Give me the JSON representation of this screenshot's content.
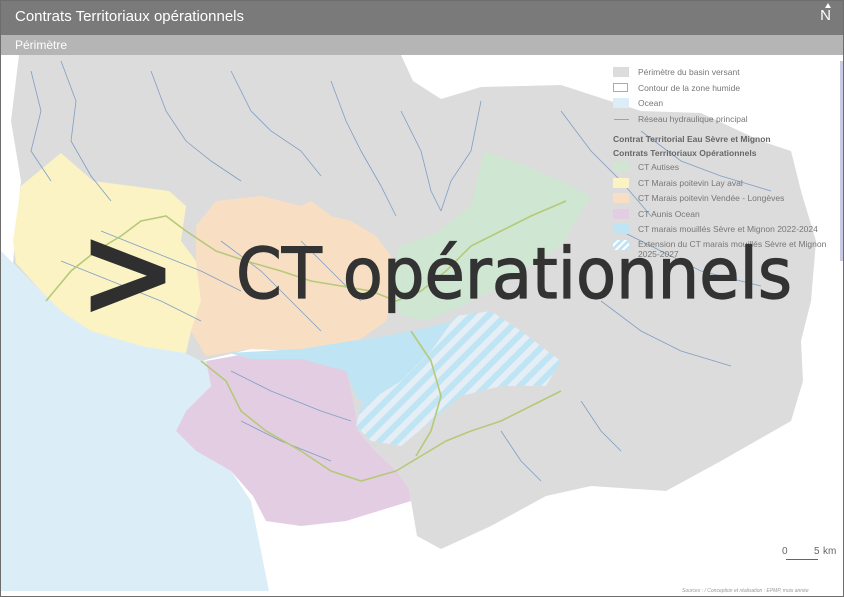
{
  "header": {
    "title": "Contrats Territoriaux opérationnels",
    "north_label": "N"
  },
  "subheader": {
    "title": "Périmètre"
  },
  "overlay": {
    "big_text": "CT opérationnels",
    "chevron_glyph": ">"
  },
  "legend": {
    "basin": "Périmètre du basin versant",
    "wetland": "Contour de la zone humide",
    "ocean": "Ocean",
    "network": "Réseau hydraulique principal",
    "section_heading": "Contrat Territorial Eau Sèvre et Mignon",
    "ct_heading": "Contrats Territoriaux Opérationnels",
    "items": [
      {
        "label": "CT Autises",
        "color": "#cfe6d2"
      },
      {
        "label": "CT Marais poitevin Lay aval",
        "color": "#fbf3c4"
      },
      {
        "label": "CT Marais poitevin Vendée - Longèves",
        "color": "#f8dfc4"
      },
      {
        "label": "CT Aunis Ocean",
        "color": "#e3cde2"
      },
      {
        "label": "CT marais mouillés Sèvre et Mignon 2022-2024",
        "color": "#bfe4f4"
      },
      {
        "label": "Extension du CT marais mouillés Sèvre et Mignon 2025-2027",
        "color": "#bfe4f4"
      }
    ]
  },
  "colors": {
    "basin": "#dcdcdc",
    "ocean": "#dbeef8",
    "wetland": "#b6c978",
    "rivers": "#7f9ec4",
    "autises": "#cfe6d2",
    "lay": "#fbf3c4",
    "vendee": "#f8dfc4",
    "aunis": "#e3cde2",
    "sevre": "#bfe4f4"
  },
  "scale": {
    "zero": "0",
    "five": "5",
    "unit": "km"
  },
  "sources": "Sources : / Conception et réalisation : EPMP, mois année"
}
